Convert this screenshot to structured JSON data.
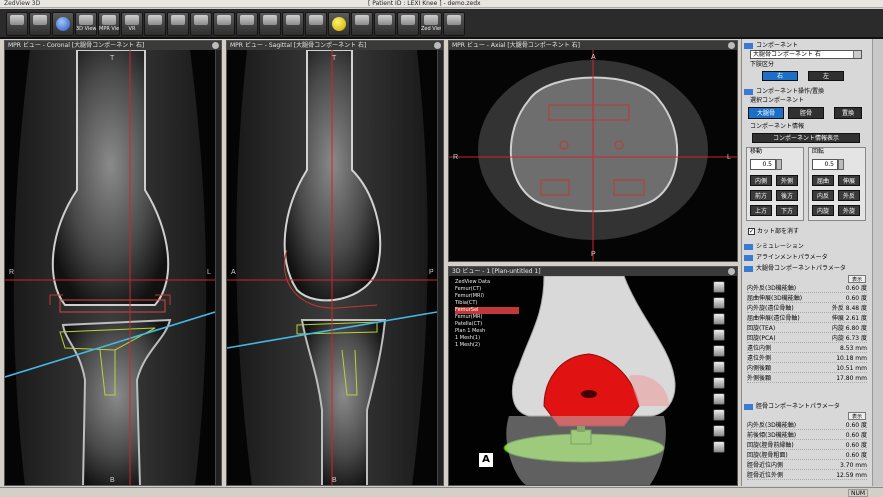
{
  "window": {
    "app_title": "ZedView 3D",
    "doc_title": "[ Patient ID : LEXI Knee ]  -  demo.zedx"
  },
  "toolbar": [
    {
      "label": "",
      "icon": "db-icon"
    },
    {
      "label": "",
      "icon": "db2-icon"
    },
    {
      "label": "Info",
      "icon": "info-icon"
    },
    {
      "label": "3D View",
      "icon": "3d-view-icon"
    },
    {
      "label": "MPR View",
      "icon": "mpr-view-icon"
    },
    {
      "label": "VR",
      "icon": "vr-icon"
    },
    {
      "label": "",
      "icon": "layout-1-icon"
    },
    {
      "label": "",
      "icon": "layout-2-icon"
    },
    {
      "label": "",
      "icon": "layout-3-icon"
    },
    {
      "label": "",
      "icon": "layout-4-icon"
    },
    {
      "label": "",
      "icon": "camera-icon"
    },
    {
      "label": "",
      "icon": "ruler-icon"
    },
    {
      "label": "",
      "icon": "grid-icon"
    },
    {
      "label": "",
      "icon": "film-icon"
    },
    {
      "label": "",
      "icon": "sphere-icon"
    },
    {
      "label": "",
      "icon": "plane-icon"
    },
    {
      "label": "",
      "icon": "book-icon"
    },
    {
      "label": "",
      "icon": "columns-icon"
    },
    {
      "label": "Zed View",
      "icon": "zed-view-icon"
    },
    {
      "label": "",
      "icon": "power-icon"
    }
  ],
  "viewports": {
    "coronal": {
      "title": "MPR ビュー - Coronal [大腿骨コンポーネント 右]",
      "top": "T",
      "bottom": "B",
      "left": "R",
      "right": "L"
    },
    "sagittal": {
      "title": "MPR ビュー - Sagittal [大腿骨コンポーネント 右]",
      "top": "T",
      "bottom": "B",
      "left": "A",
      "right": "P"
    },
    "axial": {
      "title": "MPR ビュー - Axial [大腿骨コンポーネント 右]",
      "top": "A",
      "bottom": "P",
      "left": "R",
      "right": "L"
    },
    "view3d": {
      "title": "3D ビュー - 1 [Plan-untitled 1]",
      "corner_label": "A",
      "tree": [
        "ZedView Data",
        "Femur(CT)",
        "Femur(MRI)",
        "Tibia(CT)",
        "FemurSel",
        "Femur(MR)",
        "Patella(CT)",
        "Plan 1 Mesh",
        "1 Mesh(1)",
        "1 Mesh(2)"
      ],
      "tree_highlight_index": 4
    }
  },
  "panel": {
    "target_header": "コンポーネント",
    "target_value": "大腿骨コンポーネント 右",
    "side_header": "下肢区分",
    "side_right": "右",
    "side_left": "左",
    "component_ops_header": "コンポーネント操作/置換",
    "select_component_header": "選択コンポーネント",
    "femur_btn": "大腿骨",
    "tibia_btn": "脛骨",
    "replace_btn": "置換",
    "info_header": "コンポーネント情報",
    "info_btn": "コンポーネント情報表示",
    "move_header": "移動",
    "rotate_header": "回転",
    "move_value": "0.5",
    "rotate_value": "0.5",
    "move_buttons": [
      "内側",
      "外側",
      "前方",
      "後方",
      "上方",
      "下方"
    ],
    "rotate_buttons": [
      "屈曲",
      "伸展",
      "内反",
      "外反",
      "内旋",
      "外旋"
    ],
    "cut_label": "カット部を消す",
    "sim_header": "シミュレーション",
    "align_header": "アラインメントパラメータ",
    "femur_params_header": "大腿骨コンポーネントパラメータ",
    "display_btn": "表示",
    "femur_params": [
      {
        "label": "内外反(3D機能軸)",
        "value": "0.60 度"
      },
      {
        "label": "屈曲伸展(3D機能軸)",
        "value": "0.60 度"
      },
      {
        "label": "内外旋(遠位骨軸)",
        "value": "外反 8.48 度"
      },
      {
        "label": "屈曲伸展(遠位骨軸)",
        "value": "伸展 2.61 度"
      },
      {
        "label": "回旋(TEA)",
        "value": "内旋 6.80 度"
      },
      {
        "label": "回旋(PCA)",
        "value": "内旋 6.73 度"
      },
      {
        "label": "遠位内側",
        "value": "8.53 mm"
      },
      {
        "label": "遠位外側",
        "value": "10.18 mm"
      },
      {
        "label": "内側後顆",
        "value": "10.51 mm"
      },
      {
        "label": "外側後顆",
        "value": "17.80 mm"
      }
    ],
    "tibia_params_header": "脛骨コンポーネントパラメータ",
    "tibia_params": [
      {
        "label": "内外反(3D機能軸)",
        "value": "0.60 度"
      },
      {
        "label": "前後傾(3D機能軸)",
        "value": "0.60 度"
      },
      {
        "label": "回旋(脛骨前縁軸)",
        "value": "0.60 度"
      },
      {
        "label": "回旋(脛骨粗面)",
        "value": "0.60 度"
      },
      {
        "label": "脛骨近位内側",
        "value": "3.70 mm"
      },
      {
        "label": "脛骨近位外側",
        "value": "12.59 mm"
      }
    ]
  },
  "status": {
    "num": "NUM"
  }
}
